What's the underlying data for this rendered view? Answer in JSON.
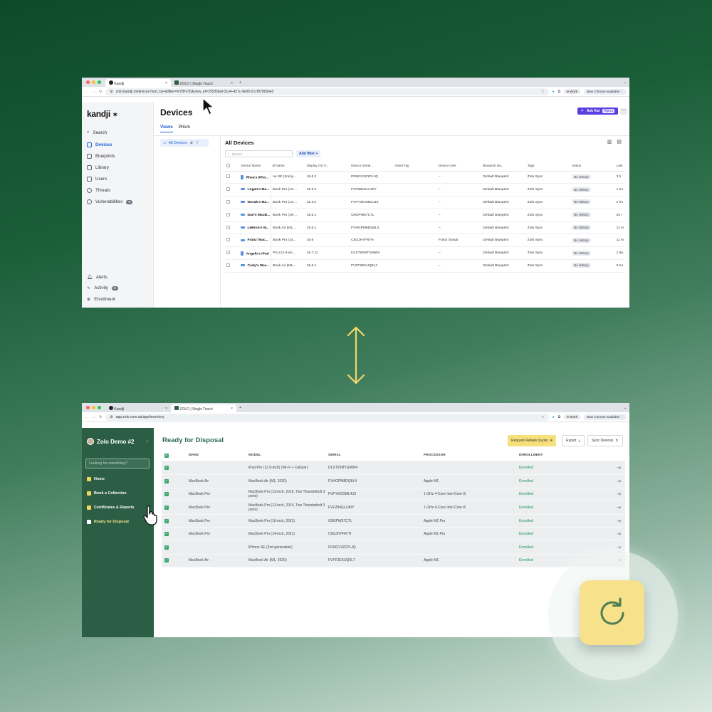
{
  "kandji": {
    "browser": {
      "tabs": [
        "Kandji",
        "ZOLO | Single Touch"
      ],
      "url": "zolo.kandji.io/devices?sort_by=&filter=%7B%7D&view_id=25535baf-31e4-427c-9e00-21cf970b5b42",
      "profile": "Work",
      "update": "New Chrome available"
    },
    "sidebar": {
      "logo": "kandji",
      "search": "Search",
      "items": [
        "Devices",
        "Blueprints",
        "Library",
        "Users",
        "Threats",
        "Vulnerabilities"
      ],
      "bottom_items": [
        "Alerts",
        "Activity",
        "Enrollment"
      ]
    },
    "header": {
      "title": "Devices",
      "tabs": [
        "Views",
        "Prism"
      ],
      "ask_kai": "Ask Kai",
      "alpha": "Alpha"
    },
    "views": {
      "label": "All Devices",
      "count": "8"
    },
    "main": {
      "title": "All Devices",
      "search_placeholder": "Search",
      "add_filter": "Add filter"
    },
    "columns": [
      "Device Name",
      "el Name",
      "Display OS V...",
      "Device Serial...",
      "Asset Tag",
      "Device User",
      "Blueprint Na...",
      "Tags",
      "Status",
      "Last"
    ],
    "rows": [
      {
        "name": "Rhea's iPho...",
        "model": "ne SE (2nd g...",
        "os": "18.6.2",
        "serial": "FFMGV3Z1PLJQ",
        "user": "–",
        "blueprint": "Default Blueprint",
        "tag": "Zolo Sync",
        "status": "No History",
        "last": "3 h",
        "type": "phone"
      },
      {
        "name": "Logan's Ma...",
        "model": "Book Pro (13-...",
        "os": "15.3.2",
        "serial": "FVFZ84GLL40Y",
        "user": "–",
        "blueprint": "Default Blueprint",
        "tag": "Zolo Sync",
        "status": "No History",
        "last": "1 ho",
        "type": "laptop"
      },
      {
        "name": "Novak's Ma...",
        "model": "Book Pro (13-...",
        "os": "15.3.2",
        "serial": "FVFYWC5ML410",
        "user": "–",
        "blueprint": "Default Blueprint",
        "tag": "Zolo Sync",
        "status": "No History",
        "last": "2 ho",
        "type": "laptop"
      },
      {
        "name": "Dan's MacB...",
        "model": "Book Pro (16-...",
        "os": "15.6.1",
        "serial": "G9GPW57C7L",
        "user": "–",
        "blueprint": "Default Blueprint",
        "tag": "Zolo Sync",
        "status": "No History",
        "last": "53 r",
        "type": "laptop"
      },
      {
        "name": "LeBron's M...",
        "model": "Book Air (M1,...",
        "os": "15.6.1",
        "serial": "FVHGPM8DQ6L4",
        "user": "–",
        "blueprint": "Default Blueprint",
        "tag": "Zolo Sync",
        "status": "No History",
        "last": "11 m",
        "type": "laptop"
      },
      {
        "name": "Franz' Mac...",
        "model": "Book Pro (14...",
        "os": "15.6",
        "serial": "C5GJH7FR7H",
        "user": "Franz Siasat",
        "blueprint": "Default Blueprint",
        "tag": "Zolo Sync",
        "status": "No History",
        "last": "11 m",
        "type": "laptop"
      },
      {
        "name": "Angelo's iPad",
        "model": "Pro (12.9-inc...",
        "os": "16.7.11",
        "serial": "DLXT92MTGMW4",
        "user": "–",
        "blueprint": "Default Blueprint",
        "tag": "Zolo Sync",
        "status": "No History",
        "last": "1 da",
        "type": "tablet"
      },
      {
        "name": "Cody's Mac...",
        "model": "Book Air (M1,...",
        "os": "15.6.1",
        "serial": "FVFF2EKUQ6L7",
        "user": "–",
        "blueprint": "Default Blueprint",
        "tag": "Zolo Sync",
        "status": "No History",
        "last": "3 ho",
        "type": "laptop"
      }
    ]
  },
  "zolo": {
    "browser": {
      "tabs": [
        "Kandji",
        "ZOLO | Single Touch"
      ],
      "url": "app.zolo.com.au/app/inventory",
      "profile": "Work",
      "update": "New Chrome available"
    },
    "sidebar": {
      "user": "Zolo Demo #2",
      "search_placeholder": "Looking for something?",
      "items": [
        "Home",
        "Book a Collection",
        "Certificates & Reports",
        "Ready for Disposal"
      ]
    },
    "header": {
      "title": "Ready for Disposal",
      "rebate": "Request Rebate Quote",
      "export": "Export",
      "sync": "Sync Devices"
    },
    "columns": [
      "MAKE",
      "MODEL",
      "SERIAL",
      "PROCESSOR",
      "ENROLLMENT"
    ],
    "rows": [
      {
        "make": "",
        "model": "iPad Pro (12.9-inch) (Wi-Fi + Cellular)",
        "serial": "DLXT92MTGMW4",
        "processor": "",
        "enrollment": "Enrolled"
      },
      {
        "make": "MacBook Air",
        "model": "MacBook Air (M1, 2020)",
        "serial": "FVHGPM8DQ6L4",
        "processor": "Apple M1",
        "enrollment": "Enrolled"
      },
      {
        "make": "MacBook Pro",
        "model": "MacBook Pro (13-inch, 2019, Two Thunderbolt 3 ports)",
        "serial": "FVFYWC5ML410",
        "processor": "1 GHz 4-Core Intel Core i5",
        "enrollment": "Enrolled"
      },
      {
        "make": "MacBook Pro",
        "model": "MacBook Pro (13-inch, 2019, Two Thunderbolt 3 ports)",
        "serial": "FVFZ84GLL40Y",
        "processor": "1 GHz 4-Core Intel Core i5",
        "enrollment": "Enrolled"
      },
      {
        "make": "MacBook Pro",
        "model": "MacBook Pro (16-inch, 2021)",
        "serial": "G9GPW57C7L",
        "processor": "Apple M1 Pro",
        "enrollment": "Enrolled"
      },
      {
        "make": "MacBook Pro",
        "model": "MacBook Pro (14-inch, 2021)",
        "serial": "C5GJH7FR7H",
        "processor": "Apple M1 Pro",
        "enrollment": "Enrolled"
      },
      {
        "make": "",
        "model": "iPhone SE (2nd generation)",
        "serial": "FFMGV3Z1PLJQ",
        "processor": "",
        "enrollment": "Enrolled"
      },
      {
        "make": "MacBook Air",
        "model": "MacBook Air (M1, 2020)",
        "serial": "FVFF2EKUQ6L7",
        "processor": "Apple M1",
        "enrollment": "Enrolled"
      }
    ]
  },
  "colors": {
    "kandji_accent": "#1f5fd6",
    "zolo_green": "#2c5e45",
    "zolo_yellow": "#f7e18a",
    "enrolled": "#4fae7e"
  },
  "icons": [
    "arrow-cursor-icon",
    "hand-cursor-icon",
    "bidirectional-arrow-icon",
    "refresh-icon"
  ]
}
